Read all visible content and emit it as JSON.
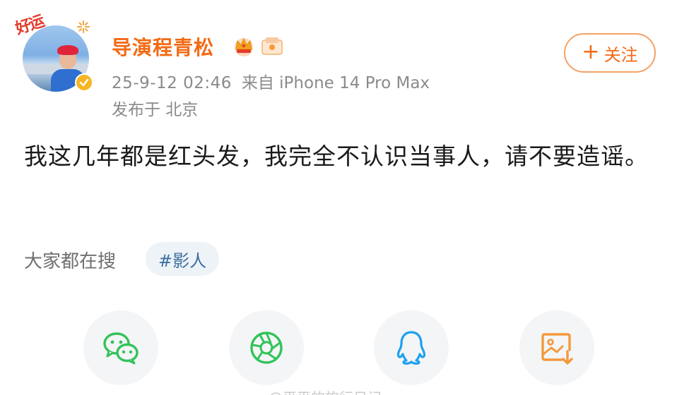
{
  "post": {
    "author": {
      "name": "导演程青松",
      "avatar_badge_text": "好运",
      "verified": true
    },
    "time": "25-9-12 02:46",
    "source": "来自 iPhone 14 Pro Max",
    "location": "发布于 北京",
    "text": "我这几年都是红头发，我完全不认识当事人，请不要造谣。",
    "follow_label": "关注"
  },
  "trending": {
    "label": "大家都在搜",
    "topic": "#影人"
  },
  "share": [
    {
      "icon": "wechat-icon",
      "color": "#33c35b"
    },
    {
      "icon": "moments-icon",
      "color": "#33c35b"
    },
    {
      "icon": "qq-icon",
      "color": "#1ea0f0"
    },
    {
      "icon": "save-image-icon",
      "color": "#f39a3c"
    }
  ],
  "watermark": "@平平的旅行日记",
  "colors": {
    "accent": "#f36a14",
    "meta_text": "#8a8a8a",
    "topic_bg": "#eef3f8",
    "topic_text": "#3d6f9e"
  }
}
